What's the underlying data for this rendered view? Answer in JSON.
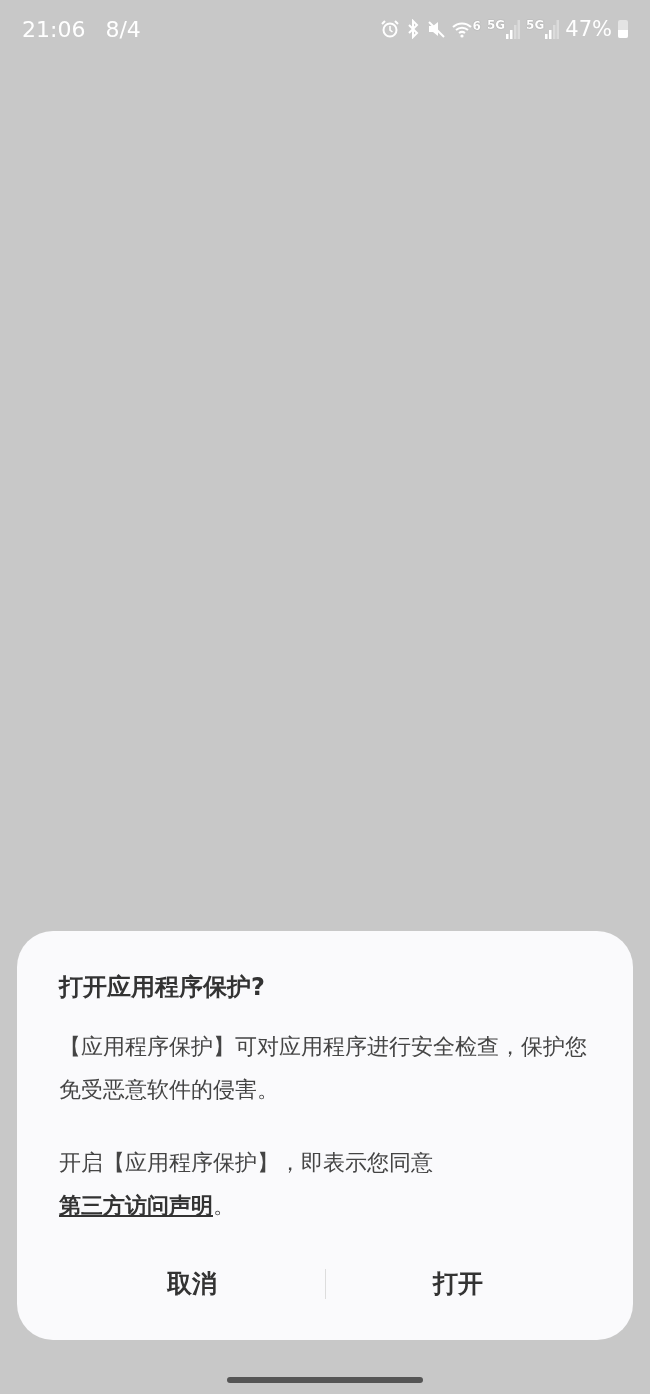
{
  "status_bar": {
    "time": "21:06",
    "date": "8/4",
    "battery": "47%",
    "indicators": [
      {
        "kind": "alarm"
      },
      {
        "kind": "bluetooth"
      },
      {
        "kind": "mute"
      },
      {
        "kind": "wifi",
        "label": "6"
      },
      {
        "kind": "signal",
        "label": "5G"
      },
      {
        "kind": "signal",
        "label": "5G"
      }
    ]
  },
  "dialog": {
    "title": "打开应用程序保护?",
    "paragraphs": [
      {
        "text": "【应用程序保护】可对应用程序进行安全检查，保护您免受恶意软件的侵害。"
      },
      {
        "text": "开启【应用程序保护】，即表示您同意",
        "link": "第三方访问声明",
        "after": "。"
      }
    ],
    "buttons": [
      {
        "label": "取消"
      },
      {
        "label": "打开"
      }
    ]
  }
}
